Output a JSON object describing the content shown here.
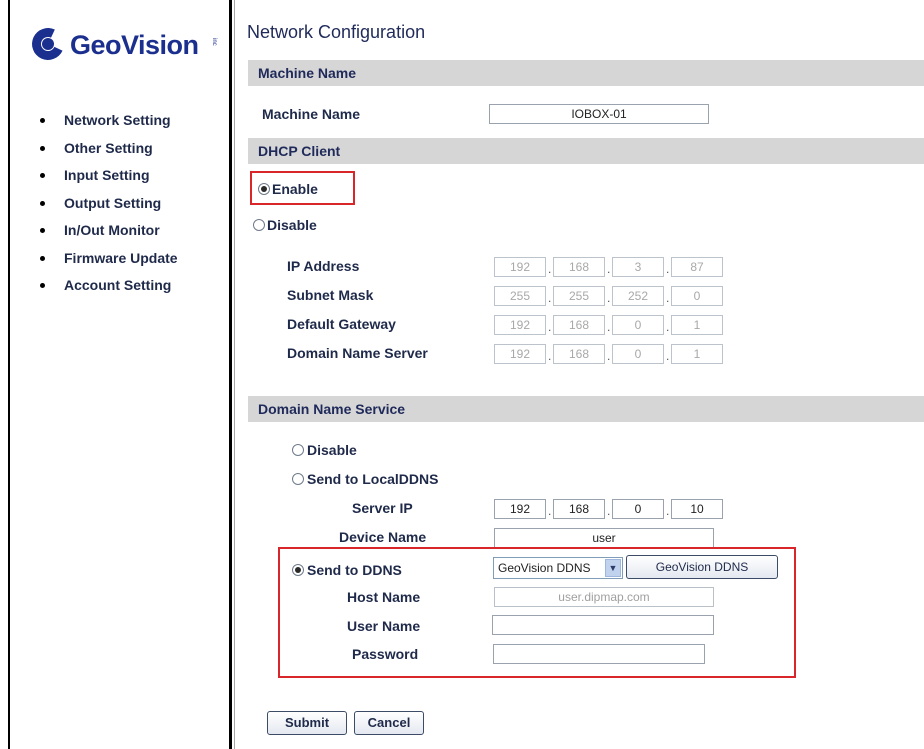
{
  "brand": {
    "name": "GeoVision",
    "suffix": "inc"
  },
  "nav": {
    "items": [
      {
        "label": "Network Setting"
      },
      {
        "label": "Other Setting"
      },
      {
        "label": "Input Setting"
      },
      {
        "label": "Output Setting"
      },
      {
        "label": "In/Out Monitor"
      },
      {
        "label": "Firmware Update"
      },
      {
        "label": "Account Setting"
      }
    ]
  },
  "page": {
    "title": "Network Configuration"
  },
  "machine": {
    "section": "Machine Name",
    "label": "Machine Name",
    "value": "IOBOX-01"
  },
  "dhcp": {
    "section": "DHCP Client",
    "enable_label": "Enable",
    "disable_label": "Disable",
    "selected": "Enable",
    "ip_label": "IP Address",
    "ip": [
      "192",
      "168",
      "3",
      "87"
    ],
    "mask_label": "Subnet Mask",
    "mask": [
      "255",
      "255",
      "252",
      "0"
    ],
    "gateway_label": "Default Gateway",
    "gateway": [
      "192",
      "168",
      "0",
      "1"
    ],
    "dns_label": "Domain Name Server",
    "dns": [
      "192",
      "168",
      "0",
      "1"
    ]
  },
  "ddns": {
    "section": "Domain Name Service",
    "disable_label": "Disable",
    "local_label": "Send to LocalDDNS",
    "server_ip_label": "Server IP",
    "server_ip": [
      "192",
      "168",
      "0",
      "10"
    ],
    "device_name_label": "Device Name",
    "device_name": "user",
    "send_ddns_label": "Send to DDNS",
    "selected": "Send to DDNS",
    "provider_selected": "GeoVision DDNS",
    "provider_button": "GeoVision DDNS",
    "host_label": "Host Name",
    "host_value": "user.dipmap.com",
    "user_label": "User Name",
    "user_value": "",
    "password_label": "Password",
    "password_value": ""
  },
  "actions": {
    "submit": "Submit",
    "cancel": "Cancel"
  },
  "colors": {
    "highlight_box": "#d8262a",
    "section_bar": "#d6d6d6",
    "brand": "#1b2f8f"
  }
}
